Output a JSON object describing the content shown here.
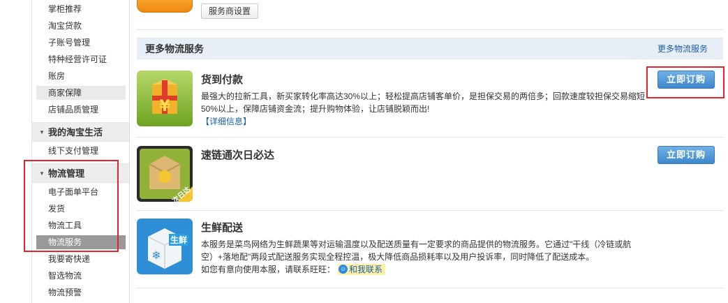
{
  "sidebar": {
    "items_top": [
      {
        "label": "掌柜推荐"
      },
      {
        "label": "淘宝贷款"
      },
      {
        "label": "子账号管理"
      },
      {
        "label": "特种经营许可证"
      },
      {
        "label": "账房"
      },
      {
        "label": "商家保障"
      },
      {
        "label": "店铺品质管理"
      }
    ],
    "group_life": {
      "title": "我的淘宝生活",
      "items": [
        {
          "label": "线下支付管理"
        }
      ]
    },
    "group_logistics": {
      "title": "物流管理",
      "items": [
        {
          "label": "电子面单平台"
        },
        {
          "label": "发货"
        },
        {
          "label": "物流工具"
        },
        {
          "label": "物流服务"
        },
        {
          "label": "我要寄快递"
        },
        {
          "label": "智选物流"
        },
        {
          "label": "物流预警"
        }
      ]
    }
  },
  "main": {
    "top_button": "服务商设置",
    "section": {
      "title": "更多物流服务",
      "more_link": "更多物流服务"
    },
    "services": [
      {
        "title": "货到付款",
        "desc": "最强大的拉新工具，新买家转化率高达30%以上；轻松提高店铺客单价，是担保交易的两倍多；回款速度较担保交易缩短50%以上，保障店铺资金流；提升购物体验，让店铺脱颖而出!",
        "detail_link": "【详细信息】",
        "button": "立即订购",
        "icon": "cod-box-icon"
      },
      {
        "title": "速链通次日必达",
        "button": "立即订购",
        "icon": "next-day-box-icon",
        "icon_badge": "次日达"
      },
      {
        "title": "生鲜配送",
        "desc": "本服务是菜鸟网络为生鲜蔬果等对运输温度以及配送质量有一定要求的商品提供的物流服务。它通过\"干线（冷链或航空）+落地配\"两段式配送服务实现全程控温，极大降低商品损耗率以及用户投诉率，同时降低了配送成本。",
        "contact_text": "如您有意向使用本服，请联系旺旺：",
        "contact_badge": "和我联系",
        "icon": "fresh-box-icon",
        "icon_badge": "生鲜"
      }
    ]
  },
  "colors": {
    "accent_blue": "#3f88cc",
    "highlight_red": "#e0262f",
    "link_blue": "#1a5fa8"
  }
}
